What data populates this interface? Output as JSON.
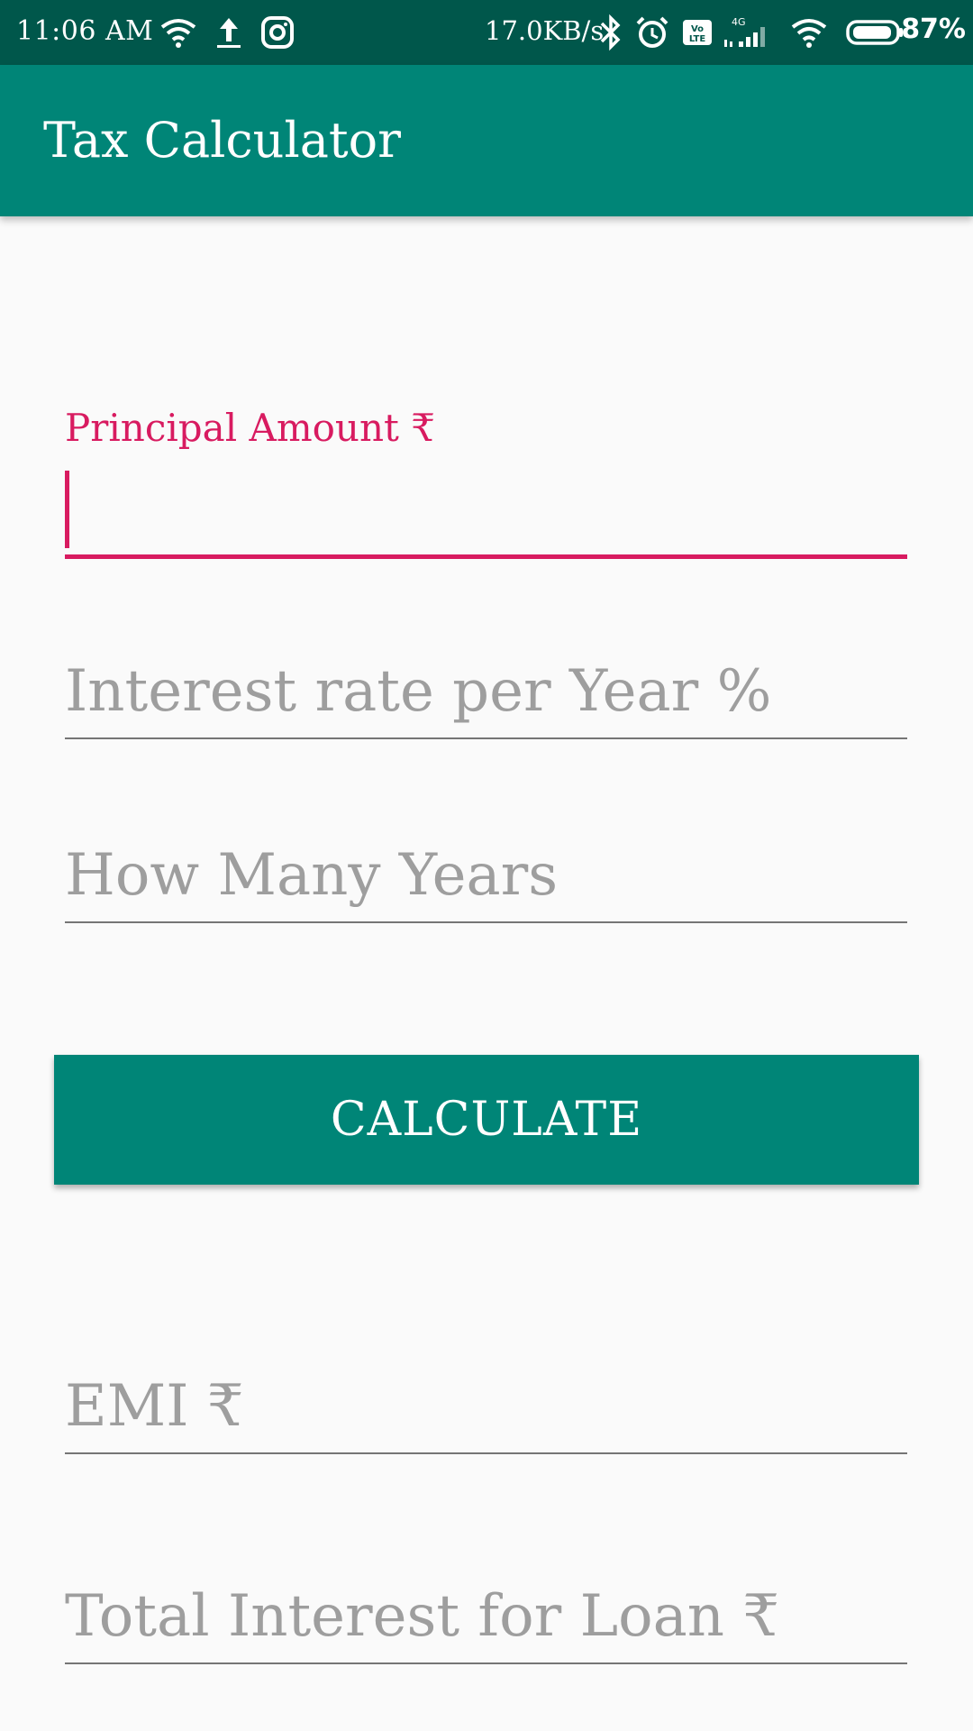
{
  "status_bar": {
    "time": "11:06 AM",
    "network_speed": "17.0KB/s",
    "battery_percent": "87%",
    "network_type": "4G",
    "icons": [
      "wifi-icon",
      "upload-icon",
      "instagram-icon",
      "bluetooth-icon",
      "alarm-icon",
      "volte-icon",
      "signal-icon",
      "wifi-icon",
      "battery-icon"
    ]
  },
  "app_bar": {
    "title": "Tax Calculator"
  },
  "form": {
    "principal": {
      "label": "Principal Amount ₹",
      "value": ""
    },
    "interest_rate": {
      "placeholder": "Interest rate per Year %"
    },
    "years": {
      "placeholder": "How Many Years"
    },
    "calculate_label": "CALCULATE",
    "emi": {
      "placeholder": "EMI ₹"
    },
    "total_interest": {
      "placeholder": "Total Interest for Loan ₹"
    }
  },
  "colors": {
    "status_bar": "#00574b",
    "primary": "#008577",
    "accent": "#d81b60",
    "hint": "#9e9e9e",
    "underline": "#757575",
    "background": "#fafafa"
  }
}
